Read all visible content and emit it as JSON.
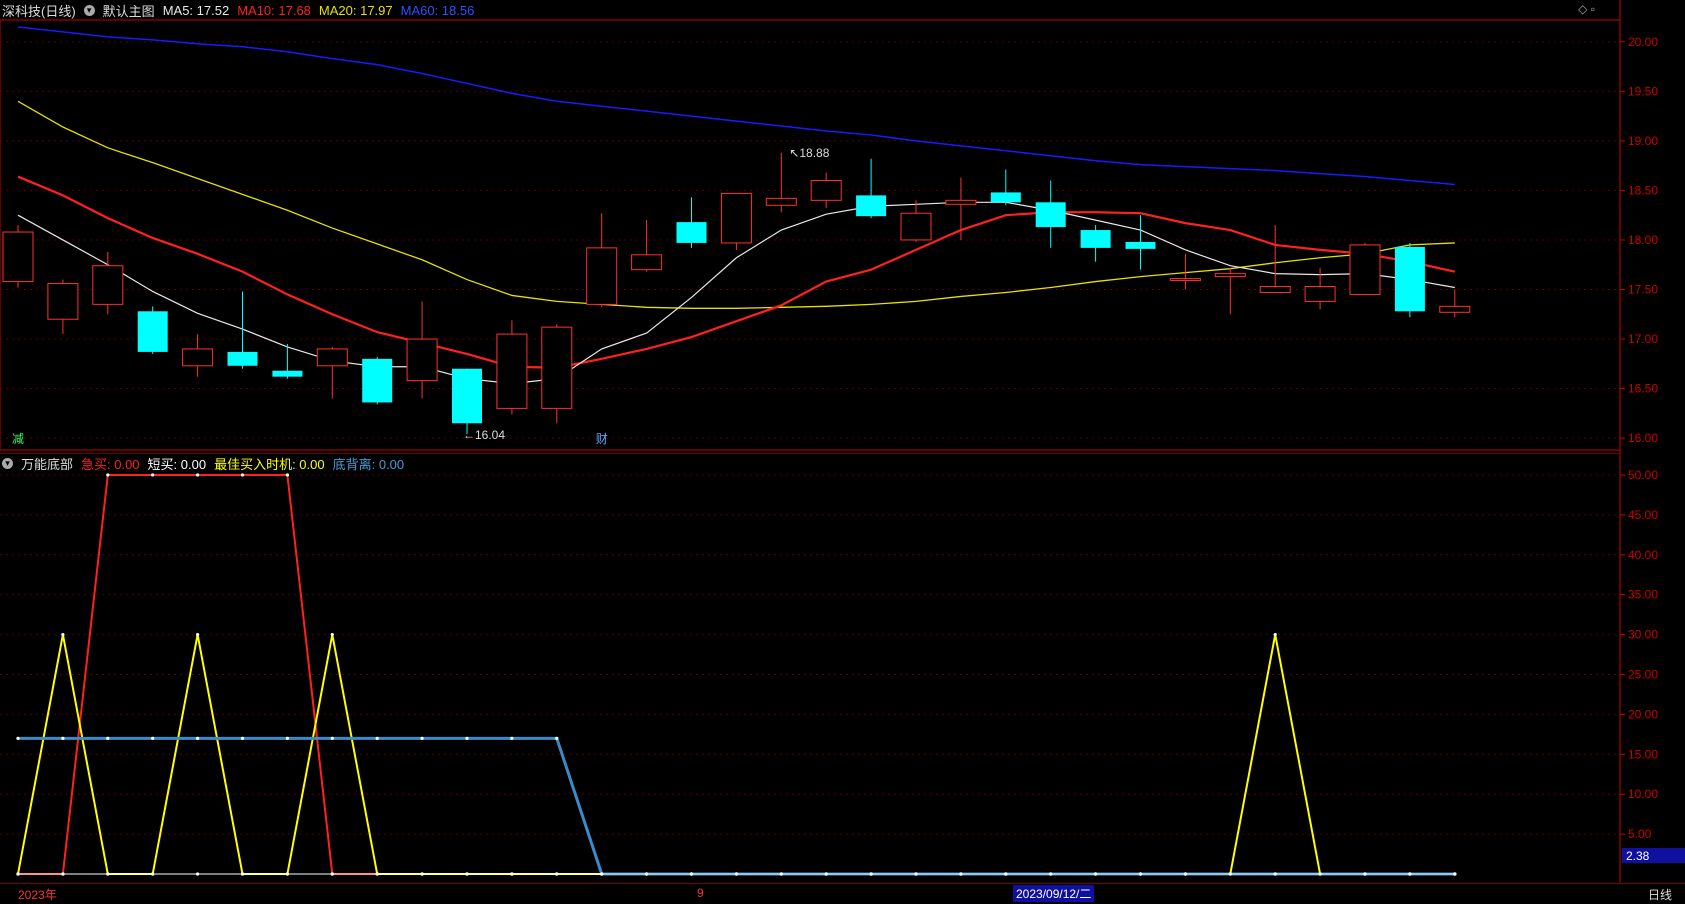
{
  "header": {
    "stock": "深科技(日线)",
    "template": "默认主图",
    "ma5": "MA5: 17.52",
    "ma10": "MA10: 17.68",
    "ma20": "MA20: 17.97",
    "ma60": "MA60: 18.56"
  },
  "sub_header": {
    "indicator": "万能底部",
    "jimai": "急买: 0.00",
    "duanmai": "短买: 0.00",
    "best": "最佳买入时机: 0.00",
    "dibeili": "底背离: 0.00"
  },
  "labels": {
    "high": "18.88",
    "low": "16.04",
    "marker_jian": "减",
    "marker_cai": "财",
    "sub_value": "2.38",
    "period": "日线"
  },
  "bottom": {
    "year": "2023年",
    "month": "9",
    "date": "2023/09/12/二"
  },
  "colors": {
    "up": "#ff3030",
    "down": "#00ffff",
    "ma5": "#e8e8e8",
    "ma10": "#ff2020",
    "ma20": "#e8e000",
    "ma60": "#1a1aff",
    "jimai": "#ff2020",
    "duanmai": "#ffffff",
    "best": "#ffff00",
    "dibeili": "#3c8ac8",
    "axis": "#cc0000"
  },
  "chart_data": [
    {
      "type": "candlestick",
      "ylim": [
        15.9,
        20.2
      ],
      "yticks": [
        "20.00",
        "19.50",
        "19.00",
        "18.50",
        "18.00",
        "17.50",
        "17.00",
        "16.50",
        "16.00"
      ],
      "candles": [
        {
          "o": 17.58,
          "c": 18.08,
          "h": 18.15,
          "l": 17.52
        },
        {
          "o": 17.2,
          "c": 17.56,
          "h": 17.6,
          "l": 17.05
        },
        {
          "o": 17.35,
          "c": 17.74,
          "h": 17.88,
          "l": 17.25
        },
        {
          "o": 17.28,
          "c": 16.87,
          "h": 17.33,
          "l": 16.85
        },
        {
          "o": 16.73,
          "c": 16.9,
          "h": 17.05,
          "l": 16.62
        },
        {
          "o": 16.87,
          "c": 16.73,
          "h": 17.48,
          "l": 16.7
        },
        {
          "o": 16.68,
          "c": 16.62,
          "h": 16.95,
          "l": 16.6
        },
        {
          "o": 16.73,
          "c": 16.9,
          "h": 16.92,
          "l": 16.4
        },
        {
          "o": 16.8,
          "c": 16.36,
          "h": 16.82,
          "l": 16.34
        },
        {
          "o": 16.58,
          "c": 17.0,
          "h": 17.38,
          "l": 16.4
        },
        {
          "o": 16.7,
          "c": 16.15,
          "h": 16.7,
          "l": 16.04
        },
        {
          "o": 16.3,
          "c": 17.05,
          "h": 17.19,
          "l": 16.24
        },
        {
          "o": 16.3,
          "c": 17.12,
          "h": 17.15,
          "l": 16.15
        },
        {
          "o": 17.35,
          "c": 17.92,
          "h": 18.27,
          "l": 17.32
        },
        {
          "o": 17.7,
          "c": 17.85,
          "h": 18.2,
          "l": 17.68
        },
        {
          "o": 18.18,
          "c": 17.97,
          "h": 18.43,
          "l": 17.92
        },
        {
          "o": 17.97,
          "c": 18.47,
          "h": 18.47,
          "l": 17.9
        },
        {
          "o": 18.35,
          "c": 18.42,
          "h": 18.88,
          "l": 18.28
        },
        {
          "o": 18.4,
          "c": 18.6,
          "h": 18.68,
          "l": 18.32
        },
        {
          "o": 18.45,
          "c": 18.24,
          "h": 18.82,
          "l": 18.22
        },
        {
          "o": 18.0,
          "c": 18.27,
          "h": 18.4,
          "l": 17.98
        },
        {
          "o": 18.36,
          "c": 18.4,
          "h": 18.63,
          "l": 18.0
        },
        {
          "o": 18.48,
          "c": 18.38,
          "h": 18.71,
          "l": 18.35
        },
        {
          "o": 18.38,
          "c": 18.13,
          "h": 18.6,
          "l": 17.92
        },
        {
          "o": 18.1,
          "c": 17.92,
          "h": 18.15,
          "l": 17.78
        },
        {
          "o": 17.98,
          "c": 17.91,
          "h": 18.25,
          "l": 17.7
        },
        {
          "o": 17.59,
          "c": 17.61,
          "h": 17.86,
          "l": 17.5
        },
        {
          "o": 17.63,
          "c": 17.66,
          "h": 17.72,
          "l": 17.25
        },
        {
          "o": 17.47,
          "c": 17.53,
          "h": 18.15,
          "l": 17.47
        },
        {
          "o": 17.38,
          "c": 17.53,
          "h": 17.72,
          "l": 17.3
        },
        {
          "o": 17.45,
          "c": 17.95,
          "h": 17.97,
          "l": 17.45
        },
        {
          "o": 17.93,
          "c": 17.28,
          "h": 17.97,
          "l": 17.22
        },
        {
          "o": 17.27,
          "c": 17.33,
          "h": 17.5,
          "l": 17.22
        }
      ],
      "ma5": [
        18.25,
        18.0,
        17.75,
        17.48,
        17.26,
        17.1,
        16.92,
        16.78,
        16.72,
        16.72,
        16.6,
        16.55,
        16.6,
        16.9,
        17.06,
        17.42,
        17.82,
        18.1,
        18.26,
        18.34,
        18.36,
        18.38,
        18.38,
        18.3,
        18.2,
        18.1,
        17.9,
        17.74,
        17.66,
        17.65,
        17.66,
        17.6,
        17.52
      ],
      "ma10": [
        18.64,
        18.45,
        18.22,
        18.02,
        17.86,
        17.68,
        17.45,
        17.25,
        17.07,
        16.96,
        16.85,
        16.72,
        16.71,
        16.8,
        16.9,
        17.02,
        17.18,
        17.34,
        17.58,
        17.7,
        17.9,
        18.1,
        18.25,
        18.28,
        18.28,
        18.27,
        18.17,
        18.1,
        17.95,
        17.9,
        17.86,
        17.78,
        17.68
      ],
      "ma20": [
        19.4,
        19.14,
        18.93,
        18.78,
        18.62,
        18.46,
        18.3,
        18.12,
        17.96,
        17.8,
        17.6,
        17.44,
        17.38,
        17.35,
        17.32,
        17.31,
        17.31,
        17.32,
        17.33,
        17.35,
        17.38,
        17.43,
        17.47,
        17.52,
        17.58,
        17.63,
        17.67,
        17.71,
        17.77,
        17.82,
        17.86,
        17.95,
        17.97
      ],
      "ma60": [
        20.15,
        20.1,
        20.05,
        20.02,
        19.98,
        19.95,
        19.9,
        19.83,
        19.77,
        19.68,
        19.58,
        19.48,
        19.4,
        19.35,
        19.3,
        19.25,
        19.2,
        19.15,
        19.1,
        19.06,
        19.0,
        18.95,
        18.9,
        18.85,
        18.8,
        18.76,
        18.74,
        18.72,
        18.7,
        18.67,
        18.64,
        18.6,
        18.56
      ]
    },
    {
      "type": "line",
      "title": "万能底部",
      "ylim": [
        0,
        52.5
      ],
      "yticks": [
        "50.00",
        "45.00",
        "40.00",
        "35.00",
        "30.00",
        "25.00",
        "20.00",
        "15.00",
        "10.00",
        "5.00"
      ],
      "series": [
        {
          "name": "急买",
          "values": [
            0,
            0,
            50,
            50,
            50,
            50,
            50,
            0,
            0,
            0,
            0,
            0,
            0,
            0,
            0,
            0,
            0,
            0,
            0,
            0,
            0,
            0,
            0,
            0,
            0,
            0,
            0,
            0,
            0,
            0,
            0,
            0,
            0
          ]
        },
        {
          "name": "最佳买入时机",
          "values": [
            0,
            30,
            0,
            0,
            30,
            0,
            0,
            30,
            0,
            0,
            0,
            0,
            0,
            0,
            0,
            0,
            0,
            0,
            0,
            0,
            0,
            0,
            0,
            0,
            0,
            0,
            0,
            0,
            30,
            0,
            0,
            0,
            0
          ]
        },
        {
          "name": "底背离",
          "values": [
            17,
            17,
            17,
            17,
            17,
            17,
            17,
            17,
            17,
            17,
            17,
            17,
            17,
            0,
            0,
            0,
            0,
            0,
            0,
            0,
            0,
            0,
            0,
            0,
            0,
            0,
            0,
            0,
            0,
            0,
            0,
            0,
            0
          ]
        },
        {
          "name": "短买",
          "values": [
            0,
            0,
            0,
            0,
            0,
            0,
            0,
            0,
            0,
            0,
            0,
            0,
            0,
            0,
            0,
            0,
            0,
            0,
            0,
            0,
            0,
            0,
            0,
            0,
            0,
            0,
            0,
            0,
            0,
            0,
            0,
            0,
            0
          ]
        }
      ]
    }
  ]
}
